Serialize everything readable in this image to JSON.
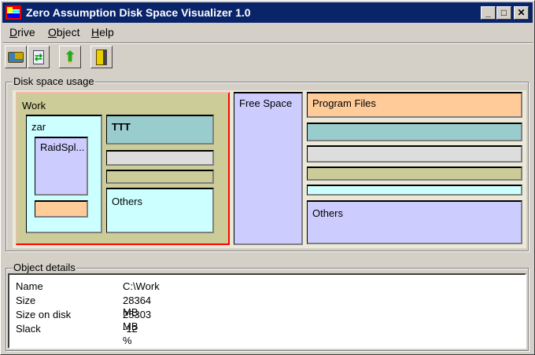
{
  "window": {
    "title": "Zero Assumption Disk Space Visualizer 1.0",
    "controls": {
      "minimize": "_",
      "maximize": "□",
      "close": "✕"
    }
  },
  "menu": [
    {
      "label": "Drive",
      "accel": "D",
      "rest": "rive"
    },
    {
      "label": "Object",
      "accel": "O",
      "rest": "bject"
    },
    {
      "label": "Help",
      "accel": "H",
      "rest": "elp"
    }
  ],
  "toolbar": [
    {
      "icon": "open-drive-icon"
    },
    {
      "icon": "refresh-icon"
    },
    {
      "icon": "up-folder-icon"
    },
    {
      "icon": "exit-door-icon"
    }
  ],
  "usage": {
    "label": "Disk space usage",
    "work": {
      "label": "Work",
      "color": "#cccc99",
      "zar": {
        "label": "zar",
        "color": "#ccffff",
        "raid": {
          "label": "RaidSpl...",
          "color": "#ccccff"
        },
        "peach_color": "#ffcc99"
      },
      "ttt": {
        "label": "TTT",
        "color": "#99cccc"
      },
      "gray_color": "#dddddd",
      "olive_color": "#cccc99",
      "others": {
        "label": "Others",
        "color": "#ccffff"
      }
    },
    "free": {
      "label": "Free Space",
      "color": "#ccccff"
    },
    "program_files": {
      "label": "Program Files",
      "color": "#ffcc99"
    },
    "right_bars": [
      "#99cccc",
      "#dddddd",
      "#cccc99",
      "#ccffff"
    ],
    "others": {
      "label": "Others",
      "color": "#ccccff"
    }
  },
  "details": {
    "label": "Object details",
    "rows": [
      {
        "key": "Name",
        "value": "C:\\Work"
      },
      {
        "key": "Size",
        "value": "28364 MB"
      },
      {
        "key": "Size on disk",
        "value": "25303 MB"
      },
      {
        "key": "Slack",
        "value": "-12 %"
      }
    ]
  }
}
